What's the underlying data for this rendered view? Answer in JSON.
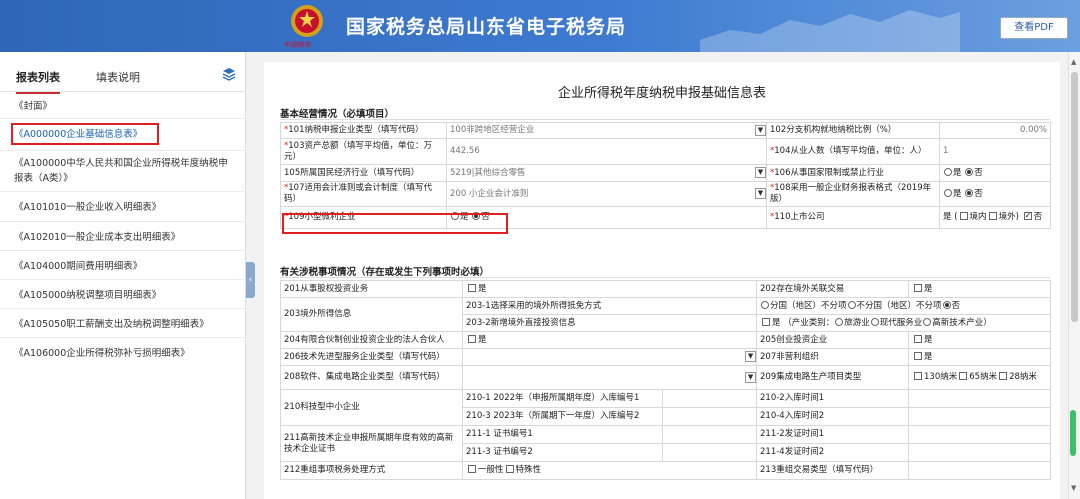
{
  "header": {
    "title": "国家税务总局山东省电子税务局",
    "emblem_caption": "中国税务",
    "pdf_button": "查看PDF"
  },
  "sidebar": {
    "tabs": [
      "报表列表",
      "填表说明"
    ],
    "items": [
      "《封面》",
      "《A000000企业基础信息表》",
      "《A100000中华人民共和国企业所得税年度纳税申报表（A类）》",
      "《A101010一般企业收入明细表》",
      "《A102010一般企业成本支出明细表》",
      "《A104000期间费用明细表》",
      "《A105000纳税调整项目明细表》",
      "《A105050职工薪酬支出及纳税调整明细表》",
      "《A106000企业所得税弥补亏损明细表》"
    ]
  },
  "form": {
    "title": "企业所得税年度纳税申报基础信息表",
    "section1": "基本经营情况（必填项目）",
    "section2": "有关涉税事项情况（存在或发生下列事项时必填）",
    "s1": {
      "r101_label": "101纳税申报企业类型（填写代码）",
      "r101_value": "100非跨地区经营企业",
      "r102_label": "102分支机构就地纳税比例（%）",
      "r102_value": "0.00%",
      "r103_label": "103资产总额（填写平均值，单位：万元）",
      "r103_value": "442.56",
      "r104_label": "104从业人数（填写平均值，单位：人）",
      "r104_value": "1",
      "r105_label": "105所属国民经济行业（填写代码）",
      "r105_value": "5219|其他综合零售",
      "r106_label": "106从事国家限制或禁止行业",
      "r107_label": "107适用会计准则或会计制度（填写代码）",
      "r107_value": "200 小企业会计准则",
      "r108_label": "108采用一般企业财务报表格式（2019年版）",
      "r109_label": "109小型微利企业",
      "r110_label": "110上市公司",
      "yes": "是",
      "no": "否",
      "domestic": "境内",
      "overseas": "境外"
    },
    "s2": {
      "r201": "201从事股权投资业务",
      "r202": "202存在境外关联交易",
      "r203": "203境外所得信息",
      "r203_1": "203-1选择采用的境外所得抵免方式",
      "r203_1_opts": [
        "分国（地区）不分项",
        "不分国（地区）不分项",
        "否"
      ],
      "r203_2": "203-2新增境外直接投资信息",
      "r203_2_text": "（产业类别：",
      "r203_2_opts": [
        "旅游业",
        "现代服务业",
        "高新技术产业"
      ],
      "r203_2_end": "）",
      "r204": "204有限合伙制创业投资企业的法人合伙人",
      "r205": "205创业投资企业",
      "r206": "206技术先进型服务企业类型（填写代码）",
      "r207": "207非营利组织",
      "r208": "208软件、集成电路企业类型（填写代码）",
      "r209": "209集成电路生产项目类型",
      "r209_opts": [
        "130纳米",
        "65纳米",
        "28纳米"
      ],
      "r210": "210科技型中小企业",
      "r210_1": "210-1 2022年（申报所属期年度）入库编号1",
      "r210_2": "210-2入库时间1",
      "r210_3": "210-3 2023年（所属期下一年度）入库编号2",
      "r210_4": "210-4入库时间2",
      "r211": "211高新技术企业申报所属期年度有效的高新技术企业证书",
      "r211_1": "211-1 证书编号1",
      "r211_2": "211-2发证时间1",
      "r211_3": "211-3 证书编号2",
      "r211_4": "211-4发证时间2",
      "r212": "212重组事项税务处理方式",
      "r212_opts": [
        "一般性",
        "特殊性"
      ],
      "r213": "213重组交易类型（填写代码）",
      "yes": "是",
      "no": "否"
    }
  }
}
